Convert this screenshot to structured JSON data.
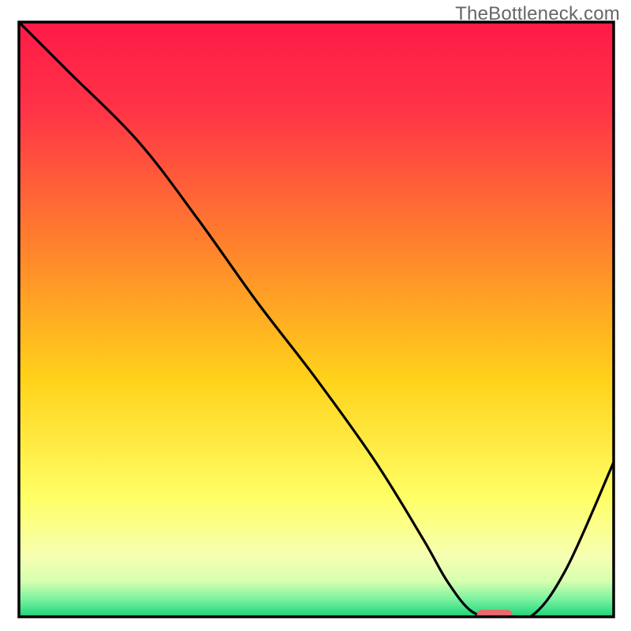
{
  "watermark": "TheBottleneck.com",
  "chart_data": {
    "type": "line",
    "title": "",
    "xlabel": "",
    "ylabel": "",
    "xlim": [
      0,
      100
    ],
    "ylim": [
      0,
      100
    ],
    "curve": {
      "x": [
        0,
        8,
        20,
        30,
        40,
        50,
        60,
        68,
        72,
        76,
        80,
        86,
        92,
        100
      ],
      "y": [
        100,
        92,
        80,
        67,
        53,
        40,
        26,
        13,
        6,
        1,
        0,
        0,
        8,
        26
      ]
    },
    "marker": {
      "type": "rounded-rect",
      "x": 80,
      "y": 0,
      "width_pct": 6,
      "color": "#E86A6A"
    },
    "background_gradient": {
      "orientation": "vertical",
      "stops": [
        {
          "pos": 0.0,
          "color": "#FF1A47"
        },
        {
          "pos": 0.15,
          "color": "#FF3447"
        },
        {
          "pos": 0.4,
          "color": "#FF8A2A"
        },
        {
          "pos": 0.6,
          "color": "#FFD21A"
        },
        {
          "pos": 0.8,
          "color": "#FFFF66"
        },
        {
          "pos": 0.9,
          "color": "#F6FFB3"
        },
        {
          "pos": 0.94,
          "color": "#D7FFB0"
        },
        {
          "pos": 0.97,
          "color": "#7CF2A0"
        },
        {
          "pos": 1.0,
          "color": "#1CD478"
        }
      ]
    },
    "axes": {
      "show_ticks": false,
      "show_grid": false,
      "frame_color": "#000000",
      "frame_linewidth": 3
    }
  }
}
